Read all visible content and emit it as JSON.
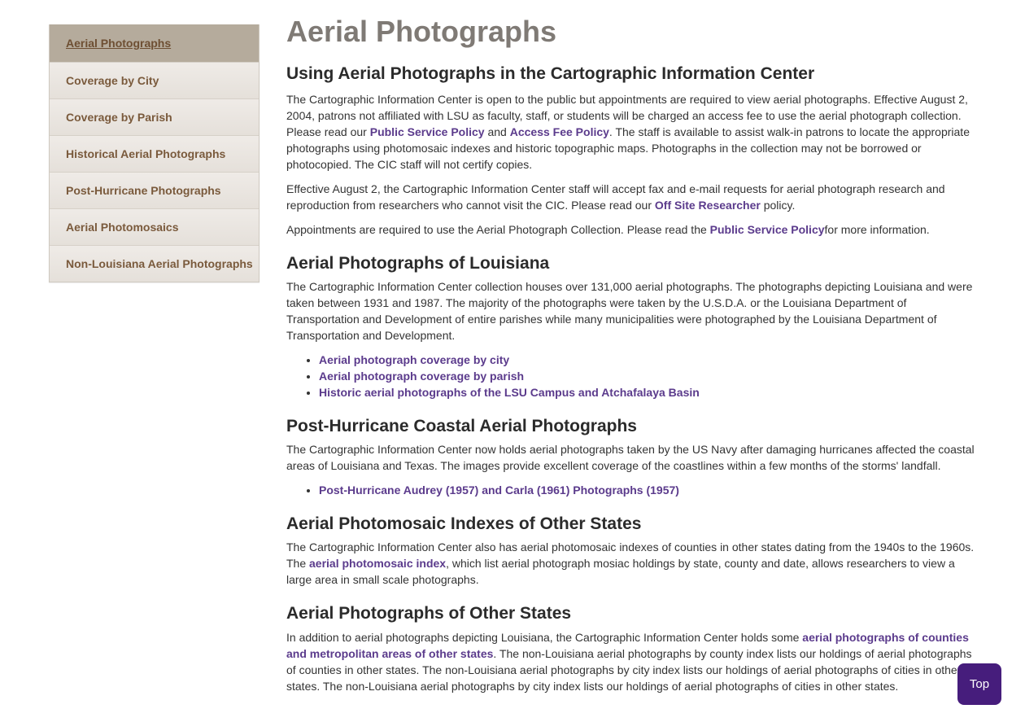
{
  "sidebar": {
    "items": [
      {
        "label": "Aerial Photographs",
        "active": true
      },
      {
        "label": "Coverage by City"
      },
      {
        "label": "Coverage by Parish"
      },
      {
        "label": "Historical Aerial Photographs"
      },
      {
        "label": "Post-Hurricane Photographs"
      },
      {
        "label": "Aerial Photomosaics"
      },
      {
        "label": "Non-Louisiana Aerial Photographs"
      }
    ]
  },
  "main": {
    "title": "Aerial Photographs",
    "s1": {
      "heading": "Using Aerial Photographs in the Cartographic Information Center",
      "p1_a": "The Cartographic Information Center is open to the public but appointments are required to view aerial photographs.  Effective August 2, 2004, patrons not affiliated with LSU as faculty, staff, or students will be charged an access fee to use the aerial photograph collection. Please read our ",
      "p1_link1": "Public Service Policy",
      "p1_b": " and ",
      "p1_link2": "Access Fee Policy",
      "p1_c": ".  The staff is available to assist walk-in patrons to locate the appropriate photographs using photomosaic indexes and historic topographic maps. Photographs in the collection may not be borrowed or photocopied. The CIC staff will not certify copies.",
      "p2_a": "Effective August 2, the Cartographic Information Center staff will accept fax and e-mail requests for aerial photograph research and reproduction from researchers who cannot visit the CIC.  Please read our ",
      "p2_link": "Off Site Researcher",
      "p2_b": " policy.",
      "p3_a": "Appointments are required to use the Aerial Photograph Collection. Please read the ",
      "p3_link": "Public Service Policy",
      "p3_b": "for more information."
    },
    "s2": {
      "heading": "Aerial Photographs of Louisiana",
      "p1": "The Cartographic Information Center collection houses over 131,000 aerial photographs. The photographs depicting Louisiana and were taken between 1931 and 1987. The majority of the photographs were taken by the U.S.D.A. or the Louisiana Department of Transportation and Development of entire parishes while many municipalities were photographed by the Louisiana Department of Transportation and Development.",
      "links": [
        "Aerial photograph coverage by city",
        "Aerial photograph coverage by parish",
        "Historic aerial photographs of the LSU Campus and Atchafalaya Basin"
      ]
    },
    "s3": {
      "heading": "Post-Hurricane Coastal Aerial Photographs",
      "p1": "The Cartographic Information Center now holds aerial photographs taken by the US Navy after damaging hurricanes affected the coastal areas of Louisiana and Texas. The images provide excellent coverage of the coastlines within a few months of the storms' landfall.",
      "links": [
        "Post-Hurricane Audrey (1957) and Carla (1961) Photographs (1957)"
      ]
    },
    "s4": {
      "heading": "Aerial Photomosaic Indexes of Other States",
      "p1_a": "The Cartographic Information Center also has aerial photomosaic indexes of counties in other states dating from the 1940s to the 1960s. The ",
      "p1_link": "aerial photomosaic index",
      "p1_b": ", which list aerial photograph mosiac holdings by state, county and date, allows researchers to view a large area in small scale photographs."
    },
    "s5": {
      "heading": "Aerial Photographs of Other States",
      "p1_a": "In addition to aerial photographs depicting Louisiana, the Cartographic Information Center holds some ",
      "p1_link": "aerial photographs of counties and metropolitan areas of other states",
      "p1_b": ". The non-Louisiana aerial photographs by county index lists our holdings of aerial photographs of counties in other states. The non-Louisiana aerial photographs by city index lists our holdings of aerial photographs of cities in other states. The non-Louisiana aerial photographs by city index lists our holdings of aerial photographs of cities in other states."
    }
  },
  "top_button": {
    "label": "Top"
  },
  "colors": {
    "link": "#5b3b8c",
    "sidebar_text": "#7a5a3c",
    "top_button_bg": "#461d7c"
  }
}
